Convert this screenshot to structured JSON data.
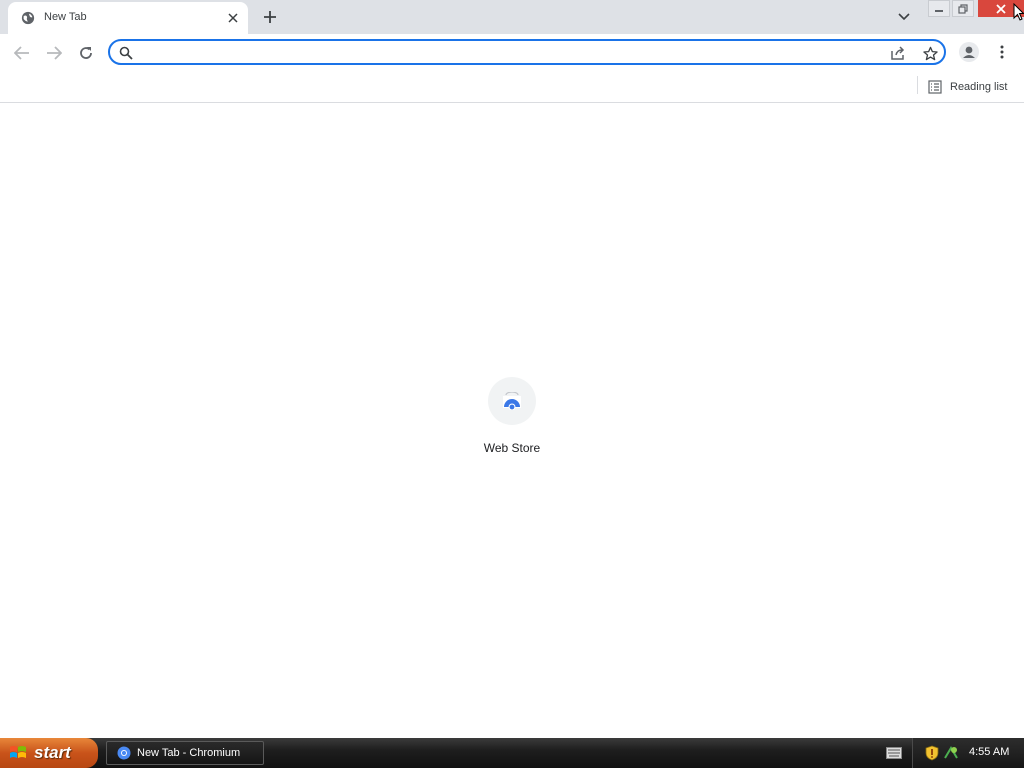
{
  "tabs": [
    {
      "title": "New Tab",
      "active": true
    }
  ],
  "toolbar": {
    "omnibox_value": "",
    "omnibox_placeholder": ""
  },
  "bookmarks_bar": {
    "reading_list_label": "Reading list"
  },
  "new_tab_page": {
    "shortcuts": [
      {
        "label": "Web Store",
        "icon": "web-store-icon"
      }
    ]
  },
  "taskbar": {
    "start_label": "start",
    "task_items": [
      {
        "label": "New Tab - Chromium",
        "icon": "chromium-icon"
      }
    ],
    "clock": "4:55 AM"
  },
  "colors": {
    "accent": "#1a73e8",
    "tabstrip_bg": "#dee1e6",
    "close_button": "#d9473d",
    "start_button": "#c9531a"
  }
}
